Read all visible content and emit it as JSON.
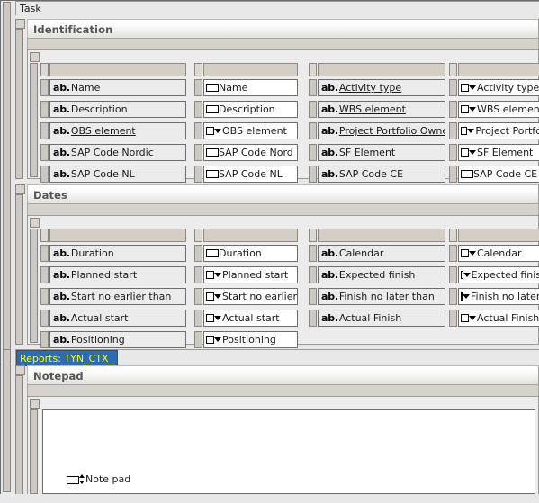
{
  "window": {
    "caption": "Task"
  },
  "groups": [
    {
      "id": "identification",
      "title": "Identification",
      "columns": [
        {
          "id": "identification-labels-left",
          "kind": "label",
          "rows": [
            {
              "prefix": "ab.",
              "text": "Name",
              "link": false
            },
            {
              "prefix": "ab.",
              "text": "Description",
              "link": false
            },
            {
              "prefix": "ab.",
              "text": "OBS element",
              "link": true
            },
            {
              "prefix": "ab.",
              "text": "SAP Code Nordic",
              "link": false
            },
            {
              "prefix": "ab.",
              "text": "SAP Code NL",
              "link": false
            }
          ]
        },
        {
          "id": "identification-fields-left",
          "kind": "field",
          "rows": [
            {
              "glyph": "textbox",
              "text": "Name"
            },
            {
              "glyph": "textbox",
              "text": "Description"
            },
            {
              "glyph": "dropdown",
              "text": "OBS element"
            },
            {
              "glyph": "textbox",
              "text": "SAP Code Nord"
            },
            {
              "glyph": "textbox",
              "text": "SAP Code NL"
            }
          ]
        },
        {
          "id": "identification-labels-right",
          "kind": "label",
          "rows": [
            {
              "prefix": "ab.",
              "text": "Activity type",
              "link": true
            },
            {
              "prefix": "ab.",
              "text": "WBS element",
              "link": true
            },
            {
              "prefix": "ab.",
              "text": "Project Portfolio Owner",
              "link": true
            },
            {
              "prefix": "ab.",
              "text": "SF Element",
              "link": false
            },
            {
              "prefix": "ab.",
              "text": "SAP Code CE",
              "link": false
            }
          ]
        },
        {
          "id": "identification-fields-right",
          "kind": "field",
          "rows": [
            {
              "glyph": "dropdown",
              "text": "Activity type"
            },
            {
              "glyph": "dropdown",
              "text": "WBS element"
            },
            {
              "glyph": "dropdown",
              "text": "Project Portfoli"
            },
            {
              "glyph": "dropdown",
              "text": "SF Element"
            },
            {
              "glyph": "textbox",
              "text": "SAP Code CE"
            }
          ]
        }
      ]
    },
    {
      "id": "dates",
      "title": "Dates",
      "columns": [
        {
          "id": "dates-labels-left",
          "kind": "label",
          "rows": [
            {
              "prefix": "ab.",
              "text": "Duration",
              "link": false
            },
            {
              "prefix": "ab.",
              "text": "Planned start",
              "link": false
            },
            {
              "prefix": "ab.",
              "text": "Start no earlier than",
              "link": false
            },
            {
              "prefix": "ab.",
              "text": "Actual start",
              "link": false
            },
            {
              "prefix": "ab.",
              "text": "Positioning",
              "link": false
            }
          ]
        },
        {
          "id": "dates-fields-left",
          "kind": "field",
          "rows": [
            {
              "glyph": "textbox",
              "text": "Duration"
            },
            {
              "glyph": "dropdown",
              "text": "Planned start"
            },
            {
              "glyph": "dropdown",
              "text": "Start no earlier"
            },
            {
              "glyph": "dropdown",
              "text": "Actual start"
            },
            {
              "glyph": "dropdown",
              "text": "Positioning"
            }
          ]
        },
        {
          "id": "dates-labels-right",
          "kind": "label",
          "rows": [
            {
              "prefix": "ab.",
              "text": "Calendar",
              "link": false
            },
            {
              "prefix": "ab.",
              "text": "Expected finish",
              "link": false
            },
            {
              "prefix": "ab.",
              "text": "Finish no later than",
              "link": false
            },
            {
              "prefix": "ab.",
              "text": "Actual Finish",
              "link": false
            }
          ]
        },
        {
          "id": "dates-fields-right",
          "kind": "field",
          "rows": [
            {
              "glyph": "dropdown",
              "text": "Calendar"
            },
            {
              "glyph": "dropdown",
              "text": "Expected finish"
            },
            {
              "glyph": "dropdown",
              "text": "Finish no later t"
            },
            {
              "glyph": "dropdown",
              "text": "Actual Finish"
            }
          ]
        }
      ]
    }
  ],
  "reports": {
    "tab_label": "Reports: TYN_CTX_"
  },
  "notepad": {
    "title": "Notepad",
    "note_glyph": "textbox-updown",
    "note_label": "Note pad"
  },
  "colors": {
    "page_background": "#e8e8e8",
    "rail": "#cdc9c2",
    "column_header": "#d4cec6",
    "label_cell": "#ebebeb",
    "field_cell": "#ffffff",
    "selected_tab_background": "#2b6db5",
    "selected_tab_text": "#ffff00",
    "group_title_text": "#555555"
  }
}
